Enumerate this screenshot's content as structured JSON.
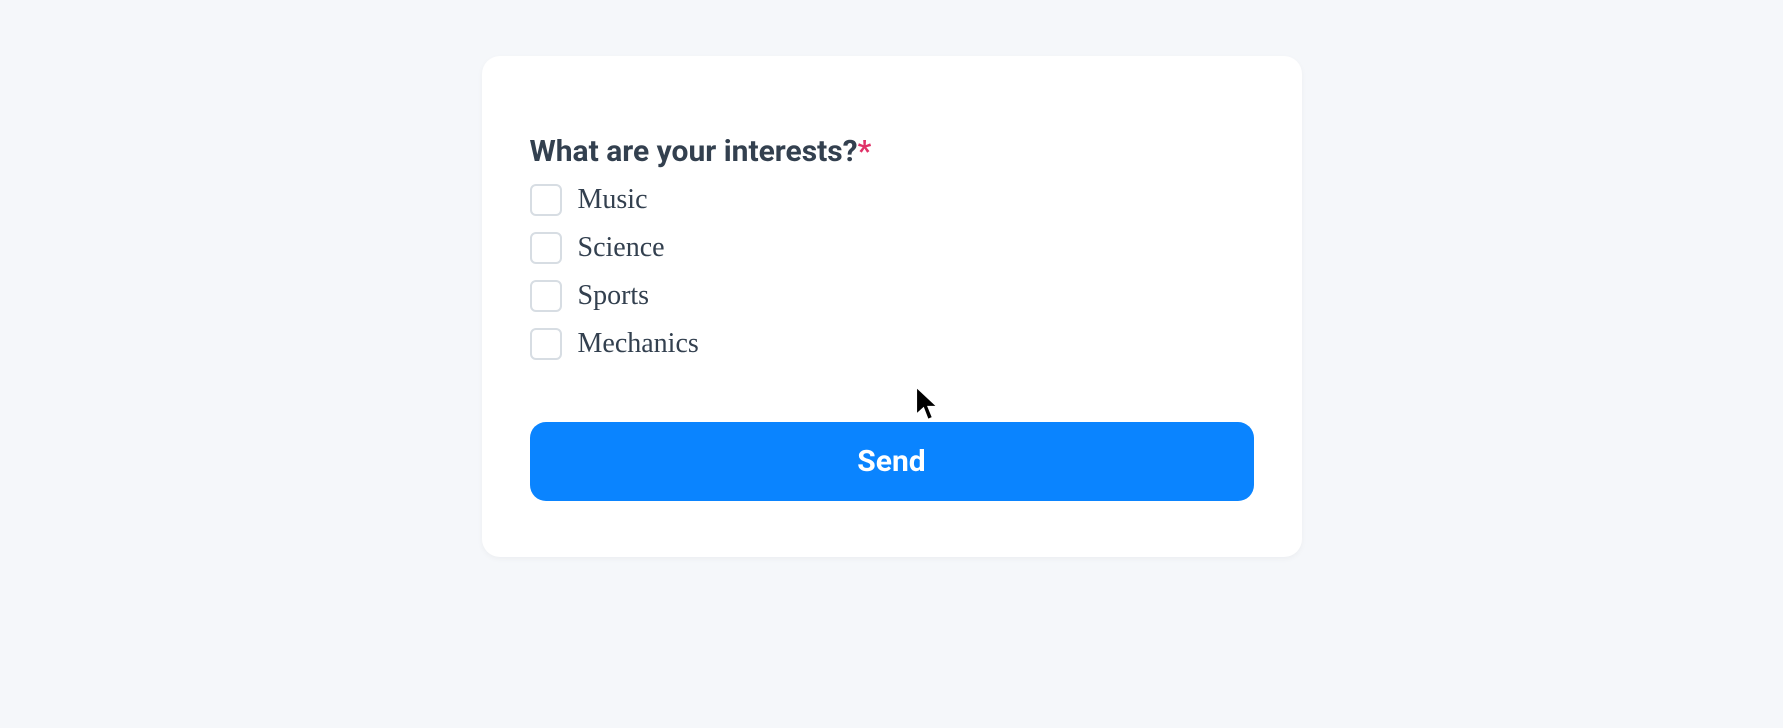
{
  "form": {
    "question_label": "What are your interests?",
    "required_marker": "*",
    "options": [
      {
        "label": "Music"
      },
      {
        "label": "Science"
      },
      {
        "label": "Sports"
      },
      {
        "label": "Mechanics"
      }
    ],
    "submit_label": "Send"
  }
}
